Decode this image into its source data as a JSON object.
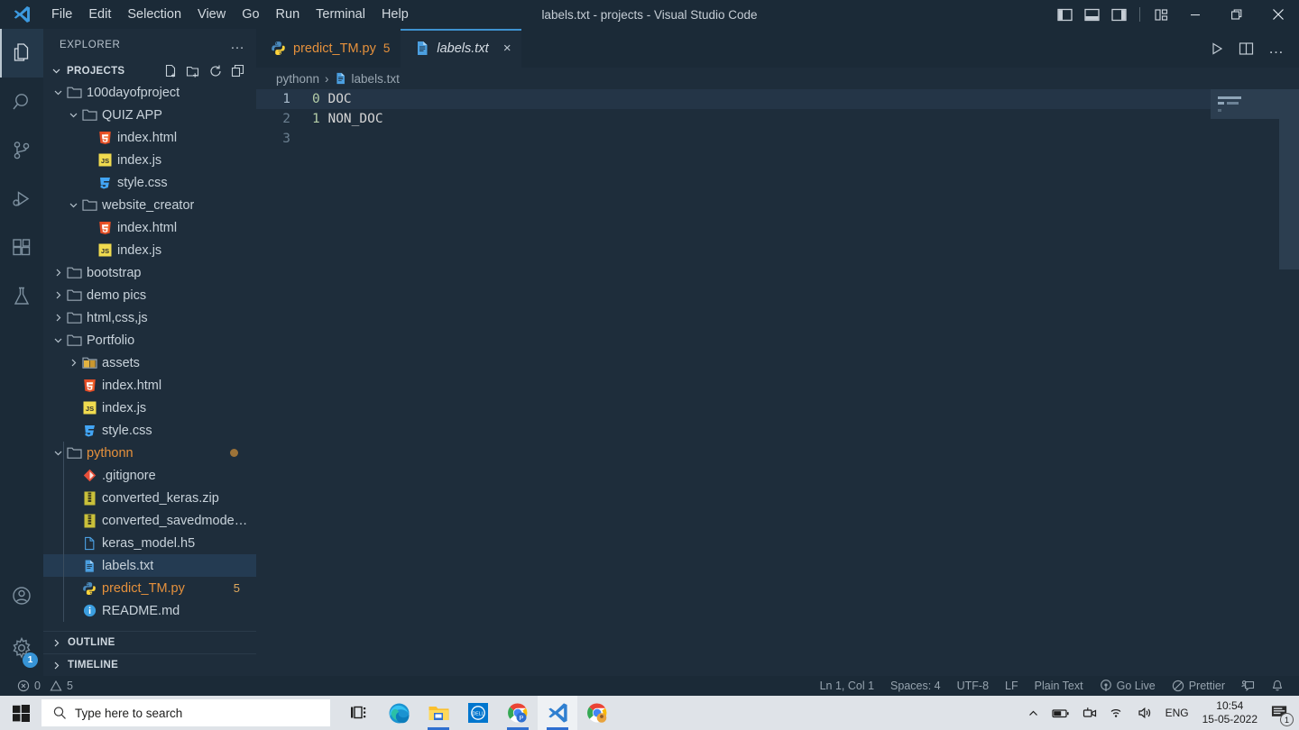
{
  "titlebar": {
    "menus": [
      "File",
      "Edit",
      "Selection",
      "View",
      "Go",
      "Run",
      "Terminal",
      "Help"
    ],
    "window_title": "labels.txt - projects - Visual Studio Code",
    "layout_icons": [
      "toggle-primary-sidebar-icon",
      "toggle-panel-icon",
      "toggle-secondary-sidebar-icon",
      "customize-layout-icon"
    ],
    "window_controls": [
      "minimize",
      "restore",
      "close"
    ]
  },
  "activitybar": {
    "items": [
      {
        "name": "explorer",
        "icon": "files-icon",
        "active": true
      },
      {
        "name": "search",
        "icon": "search-icon",
        "active": false
      },
      {
        "name": "source-control",
        "icon": "source-control-icon",
        "active": false
      },
      {
        "name": "run-and-debug",
        "icon": "run-debug-icon",
        "active": false
      },
      {
        "name": "extensions",
        "icon": "extensions-icon",
        "active": false
      },
      {
        "name": "testing",
        "icon": "beaker-icon",
        "active": false
      }
    ],
    "bottom": [
      {
        "name": "accounts",
        "icon": "account-icon",
        "badge": ""
      },
      {
        "name": "manage",
        "icon": "gear-icon",
        "badge": "1"
      }
    ]
  },
  "sidebar": {
    "header_title": "EXPLORER",
    "header_more": "…",
    "section": {
      "label": "PROJECTS",
      "expanded": true,
      "actions": [
        "new-file-icon",
        "new-folder-icon",
        "refresh-icon",
        "collapse-all-icon"
      ]
    },
    "tree": [
      {
        "label": "100dayofproject",
        "type": "folder",
        "expanded": true,
        "depth": 0
      },
      {
        "label": "QUIZ APP",
        "type": "folder",
        "expanded": true,
        "depth": 1
      },
      {
        "label": "index.html",
        "type": "html",
        "depth": 2
      },
      {
        "label": "index.js",
        "type": "js",
        "depth": 2
      },
      {
        "label": "style.css",
        "type": "css",
        "depth": 2
      },
      {
        "label": "website_creator",
        "type": "folder",
        "expanded": true,
        "depth": 1
      },
      {
        "label": "index.html",
        "type": "html",
        "depth": 2
      },
      {
        "label": "index.js",
        "type": "js",
        "depth": 2
      },
      {
        "label": "bootstrap",
        "type": "folder",
        "expanded": false,
        "depth": 0
      },
      {
        "label": "demo pics",
        "type": "folder",
        "expanded": false,
        "depth": 0
      },
      {
        "label": "html,css,js",
        "type": "folder",
        "expanded": false,
        "depth": 0
      },
      {
        "label": "Portfolio",
        "type": "folder",
        "expanded": true,
        "depth": 0
      },
      {
        "label": "assets",
        "type": "folder-assets",
        "expanded": false,
        "depth": 1
      },
      {
        "label": "index.html",
        "type": "html",
        "depth": 1
      },
      {
        "label": "index.js",
        "type": "js",
        "depth": 1
      },
      {
        "label": "style.css",
        "type": "css",
        "depth": 1
      },
      {
        "label": "pythonn",
        "type": "folder",
        "expanded": true,
        "depth": 0,
        "modified": true
      },
      {
        "label": ".gitignore",
        "type": "git",
        "depth": 1
      },
      {
        "label": "converted_keras.zip",
        "type": "zip",
        "depth": 1
      },
      {
        "label": "converted_savedmode…",
        "type": "zip",
        "depth": 1
      },
      {
        "label": "keras_model.h5",
        "type": "file",
        "depth": 1
      },
      {
        "label": "labels.txt",
        "type": "text",
        "depth": 1,
        "selected": true
      },
      {
        "label": "predict_TM.py",
        "type": "python",
        "depth": 1,
        "problems": "5",
        "modified": true
      },
      {
        "label": "README.md",
        "type": "info",
        "depth": 1
      }
    ],
    "panels": [
      {
        "label": "OUTLINE",
        "expanded": false
      },
      {
        "label": "TIMELINE",
        "expanded": false
      }
    ]
  },
  "editor": {
    "tabs": [
      {
        "label": "predict_TM.py",
        "icon": "python-icon",
        "active": false,
        "dirty": true,
        "problems": "5"
      },
      {
        "label": "labels.txt",
        "icon": "text-file-icon",
        "active": true,
        "close": "×"
      }
    ],
    "tab_actions": [
      "run-icon",
      "split-editor-icon",
      "more-actions-icon"
    ],
    "breadcrumb": [
      "pythonn",
      "labels.txt"
    ],
    "breadcrumb_separator": "›",
    "lines": [
      {
        "number": "1",
        "num_token": "0",
        "text_token": "DOC",
        "current": true
      },
      {
        "number": "2",
        "num_token": "1",
        "text_token": "NON_DOC",
        "current": false
      },
      {
        "number": "3",
        "num_token": "",
        "text_token": "",
        "current": false
      }
    ]
  },
  "statusbar": {
    "left": [
      {
        "name": "errors",
        "icon": "error-icon",
        "value": "0"
      },
      {
        "name": "warnings",
        "icon": "warning-icon",
        "value": "5"
      }
    ],
    "right": [
      {
        "name": "cursor-position",
        "label": "Ln 1, Col 1"
      },
      {
        "name": "indentation",
        "label": "Spaces: 4"
      },
      {
        "name": "encoding",
        "label": "UTF-8"
      },
      {
        "name": "eol",
        "label": "LF"
      },
      {
        "name": "language-mode",
        "label": "Plain Text"
      },
      {
        "name": "go-live",
        "label": "Go Live",
        "icon": "broadcast-icon"
      },
      {
        "name": "prettier",
        "label": "Prettier",
        "icon": "prettier-icon"
      },
      {
        "name": "remote-feedback",
        "label": "",
        "icon": "feedback-icon"
      },
      {
        "name": "notifications",
        "label": "",
        "icon": "bell-icon"
      }
    ]
  },
  "taskbar": {
    "start": "windows-start-icon",
    "search_placeholder": "Type here to search",
    "search_icon": "search-icon",
    "icons": [
      {
        "name": "task-view",
        "icon": "task-view-icon"
      },
      {
        "name": "microsoft-edge",
        "icon": "edge-icon",
        "running": true
      },
      {
        "name": "file-explorer",
        "icon": "file-explorer-icon",
        "running": true
      },
      {
        "name": "dell-app",
        "icon": "dell-icon",
        "running": false
      },
      {
        "name": "chrome-profile",
        "icon": "chrome-p-icon",
        "running": true
      },
      {
        "name": "visual-studio-code",
        "icon": "vscode-icon",
        "running": true,
        "active": true
      },
      {
        "name": "chrome",
        "icon": "chrome-icon",
        "running": false
      }
    ],
    "tray": {
      "chevron": "show-hidden-icons",
      "items": [
        "battery-icon",
        "camera-icon",
        "wifi-icon",
        "volume-icon"
      ],
      "language": "ENG",
      "time": "10:54",
      "date": "15-05-2022",
      "notification_count": "1"
    }
  }
}
